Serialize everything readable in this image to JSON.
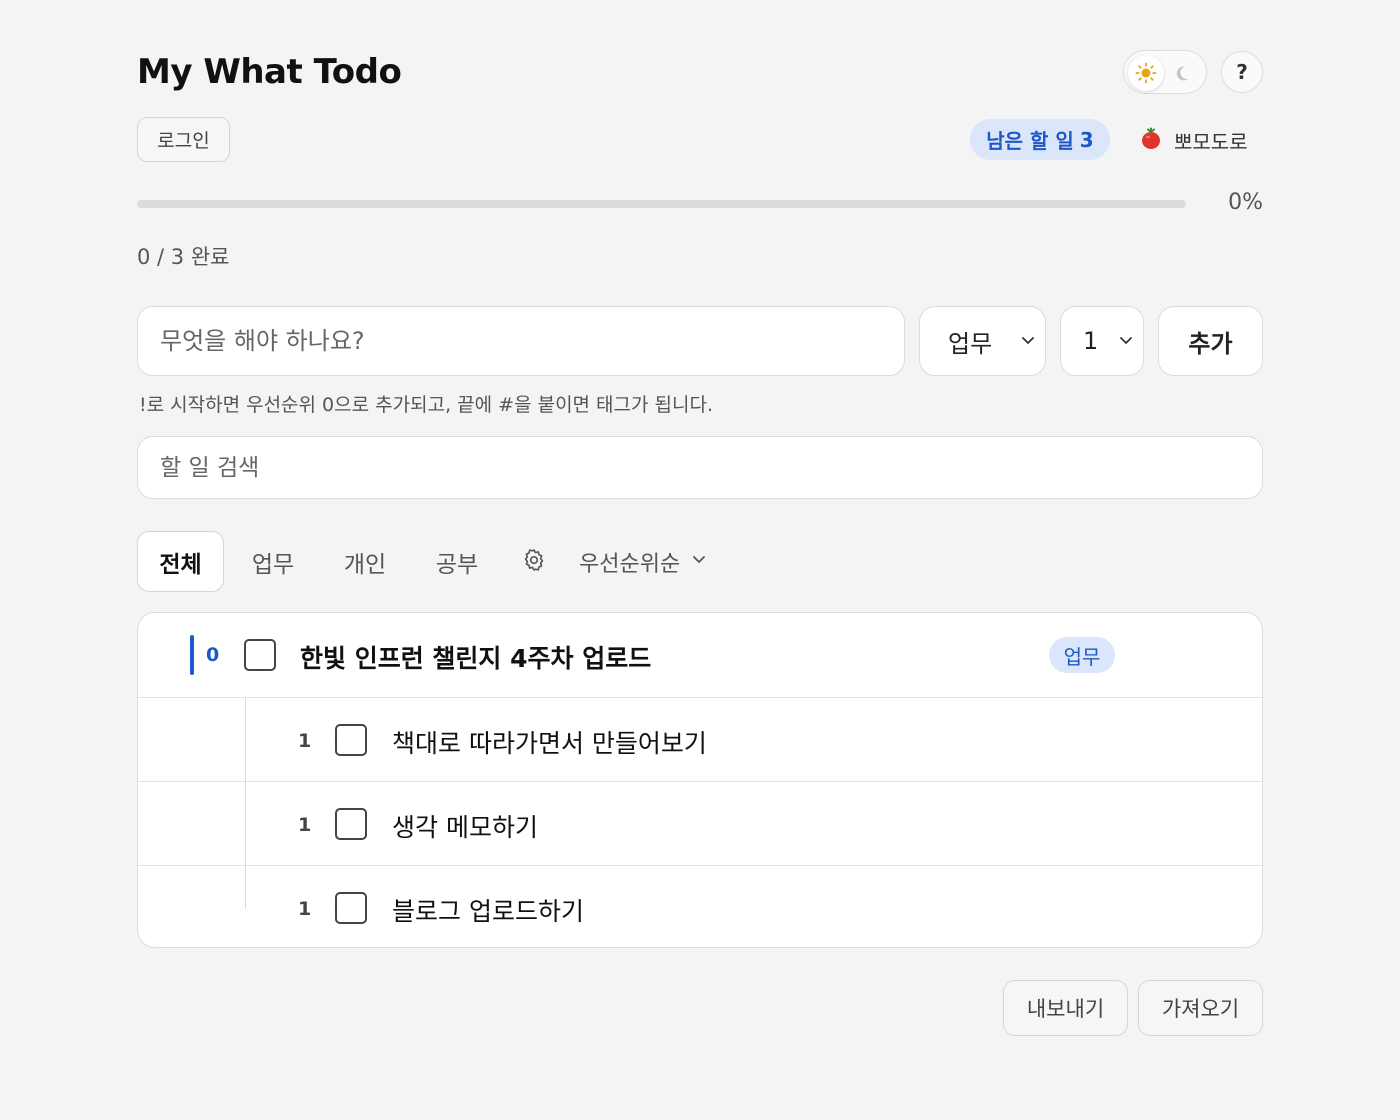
{
  "app": {
    "title": "My What Todo"
  },
  "header": {
    "help_label": "?",
    "login_label": "로그인",
    "remaining_label": "남은 할 일",
    "remaining_count": "3",
    "pomodoro_label": "뽀모도로"
  },
  "progress": {
    "percent_label": "0%",
    "fraction": 0,
    "done_label": "0 / 3 완료"
  },
  "composer": {
    "placeholder": "무엇을 해야 하나요?",
    "category_value": "업무",
    "priority_value": "1",
    "add_label": "추가",
    "hint": "!로 시작하면 우선순위 0으로 추가되고, 끝에 #을 붙이면 태그가 됩니다."
  },
  "search": {
    "placeholder": "할 일 검색"
  },
  "filters": {
    "tabs": [
      {
        "label": "전체",
        "active": true
      },
      {
        "label": "업무",
        "active": false
      },
      {
        "label": "개인",
        "active": false
      },
      {
        "label": "공부",
        "active": false
      }
    ],
    "sort_label": "우선순위순"
  },
  "tasks": [
    {
      "priority": "0",
      "text": "한빛 인프런 챌린지 4주차 업로드",
      "tag": "업무",
      "done": false,
      "level": 0
    },
    {
      "priority": "1",
      "text": "책대로 따라가면서 만들어보기",
      "done": false,
      "level": 1
    },
    {
      "priority": "1",
      "text": "생각 메모하기",
      "done": false,
      "level": 1
    },
    {
      "priority": "1",
      "text": "블로그 업로드하기",
      "done": false,
      "level": 1
    }
  ],
  "footer": {
    "export_label": "내보내기",
    "import_label": "가져오기"
  },
  "colors": {
    "accent": "#1d57c9",
    "accent_bg": "#dbe6fb",
    "pomodoro": "#e0352b",
    "sun": "#e8a317"
  }
}
